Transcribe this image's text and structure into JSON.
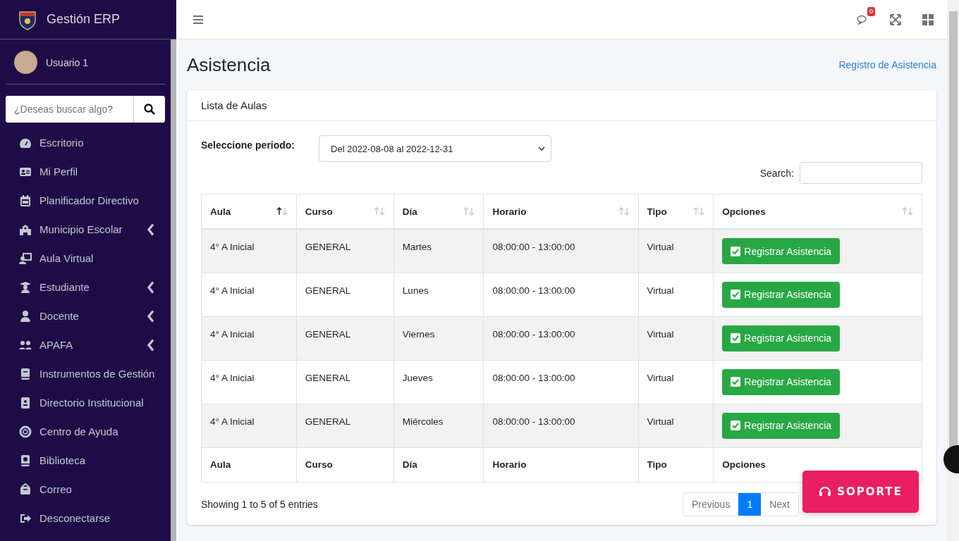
{
  "brand": {
    "title": "Gestión ERP"
  },
  "user": {
    "name": "Usuario 1"
  },
  "sidebar_search": {
    "placeholder": "¿Deseas buscar algo?"
  },
  "sidebar": {
    "items": [
      {
        "label": "Escritorio",
        "expandable": false
      },
      {
        "label": "Mi Perfil",
        "expandable": false
      },
      {
        "label": "Planificador Directivo",
        "expandable": false
      },
      {
        "label": "Municipio Escolar",
        "expandable": true
      },
      {
        "label": "Aula Virtual",
        "expandable": false
      },
      {
        "label": "Estudiante",
        "expandable": true
      },
      {
        "label": "Docente",
        "expandable": true
      },
      {
        "label": "APAFA",
        "expandable": true
      },
      {
        "label": "Instrumentos de Gestión",
        "expandable": false
      },
      {
        "label": "Directorio Institucional",
        "expandable": false
      },
      {
        "label": "Centro de Ayuda",
        "expandable": false
      },
      {
        "label": "Biblioteca",
        "expandable": false
      },
      {
        "label": "Correo",
        "expandable": false
      },
      {
        "label": "Desconectarse",
        "expandable": false
      }
    ]
  },
  "topbar": {
    "messages_badge": "0"
  },
  "page": {
    "title": "Asistencia",
    "breadcrumb": "Registro de Asistencia"
  },
  "card": {
    "title": "Lista de Aulas",
    "period": {
      "label": "Seleccione periodo:",
      "value": "Del 2022-08-08 al 2022-12-31"
    },
    "search": {
      "label": "Search:"
    },
    "table": {
      "columns": [
        {
          "label": "Aula",
          "sorted": true
        },
        {
          "label": "Curso",
          "sorted": false
        },
        {
          "label": "Día",
          "sorted": false
        },
        {
          "label": "Horario",
          "sorted": false
        },
        {
          "label": "Tipo",
          "sorted": false
        },
        {
          "label": "Opciones",
          "sorted": false
        }
      ],
      "rows": [
        {
          "aula": "4° A Inicial",
          "curso": "GENERAL",
          "dia": "Martes",
          "horario": "08:00:00 - 13:00:00",
          "tipo": "Virtual",
          "action": "Registrar Asistencia"
        },
        {
          "aula": "4° A Inicial",
          "curso": "GENERAL",
          "dia": "Lunes",
          "horario": "08:00:00 - 13:00:00",
          "tipo": "Virtual",
          "action": "Registrar Asistencia"
        },
        {
          "aula": "4° A Inicial",
          "curso": "GENERAL",
          "dia": "Viernes",
          "horario": "08:00:00 - 13:00:00",
          "tipo": "Virtual",
          "action": "Registrar Asistencia"
        },
        {
          "aula": "4° A Inicial",
          "curso": "GENERAL",
          "dia": "Jueves",
          "horario": "08:00:00 - 13:00:00",
          "tipo": "Virtual",
          "action": "Registrar Asistencia"
        },
        {
          "aula": "4° A Inicial",
          "curso": "GENERAL",
          "dia": "Miércoles",
          "horario": "08:00:00 - 13:00:00",
          "tipo": "Virtual",
          "action": "Registrar Asistencia"
        }
      ],
      "footer": [
        "Aula",
        "Curso",
        "Día",
        "Horario",
        "Tipo",
        "Opciones"
      ]
    },
    "info": "Showing 1 to 5 of 5 entries",
    "pagination": [
      {
        "label": "Previous",
        "selected": false
      },
      {
        "label": "1",
        "selected": true
      },
      {
        "label": "Next",
        "selected": false
      }
    ]
  },
  "support_button": {
    "label": "SOPORTE"
  }
}
